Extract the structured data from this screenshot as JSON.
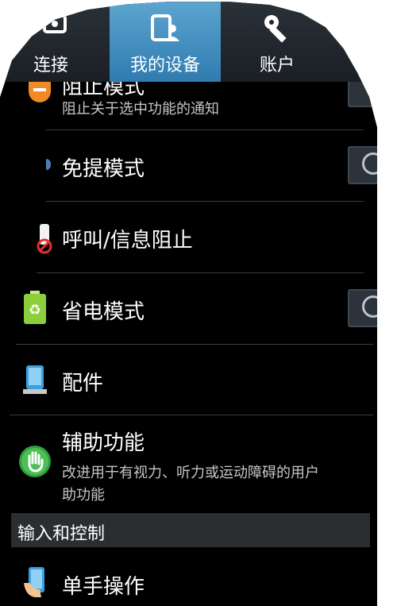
{
  "tabs": [
    {
      "label": "连接",
      "icon": "connections-icon",
      "selected": false
    },
    {
      "label": "我的设备",
      "icon": "my-device-icon",
      "selected": true
    },
    {
      "label": "账户",
      "icon": "account-key-icon",
      "selected": false
    }
  ],
  "settings": {
    "blocking_mode": {
      "title": "阻止模式",
      "subtitle": "阻止关于选中功能的通知",
      "icon": "blocking-mode-icon"
    },
    "hands_free": {
      "title": "免提模式",
      "icon": "hands-free-icon"
    },
    "call_block": {
      "title": "呼叫/信息阻止",
      "icon": "call-block-icon"
    },
    "power_saving": {
      "title": "省电模式",
      "icon": "power-saving-icon"
    },
    "accessories": {
      "title": "配件",
      "icon": "accessory-icon"
    },
    "accessibility": {
      "title": "辅助功能",
      "subtitle_line1": "改进用于有视力、听力或运动障碍的用户",
      "subtitle_line2": "助功能",
      "icon": "accessibility-hand-icon"
    },
    "input_section": {
      "title": "输入和控制"
    },
    "one_hand": {
      "title": "单手操作",
      "icon": "one-hand-icon"
    }
  },
  "colors": {
    "selected_tab": "#3d8fc2",
    "background": "#000000",
    "toggle_bg": "#2c333a"
  }
}
